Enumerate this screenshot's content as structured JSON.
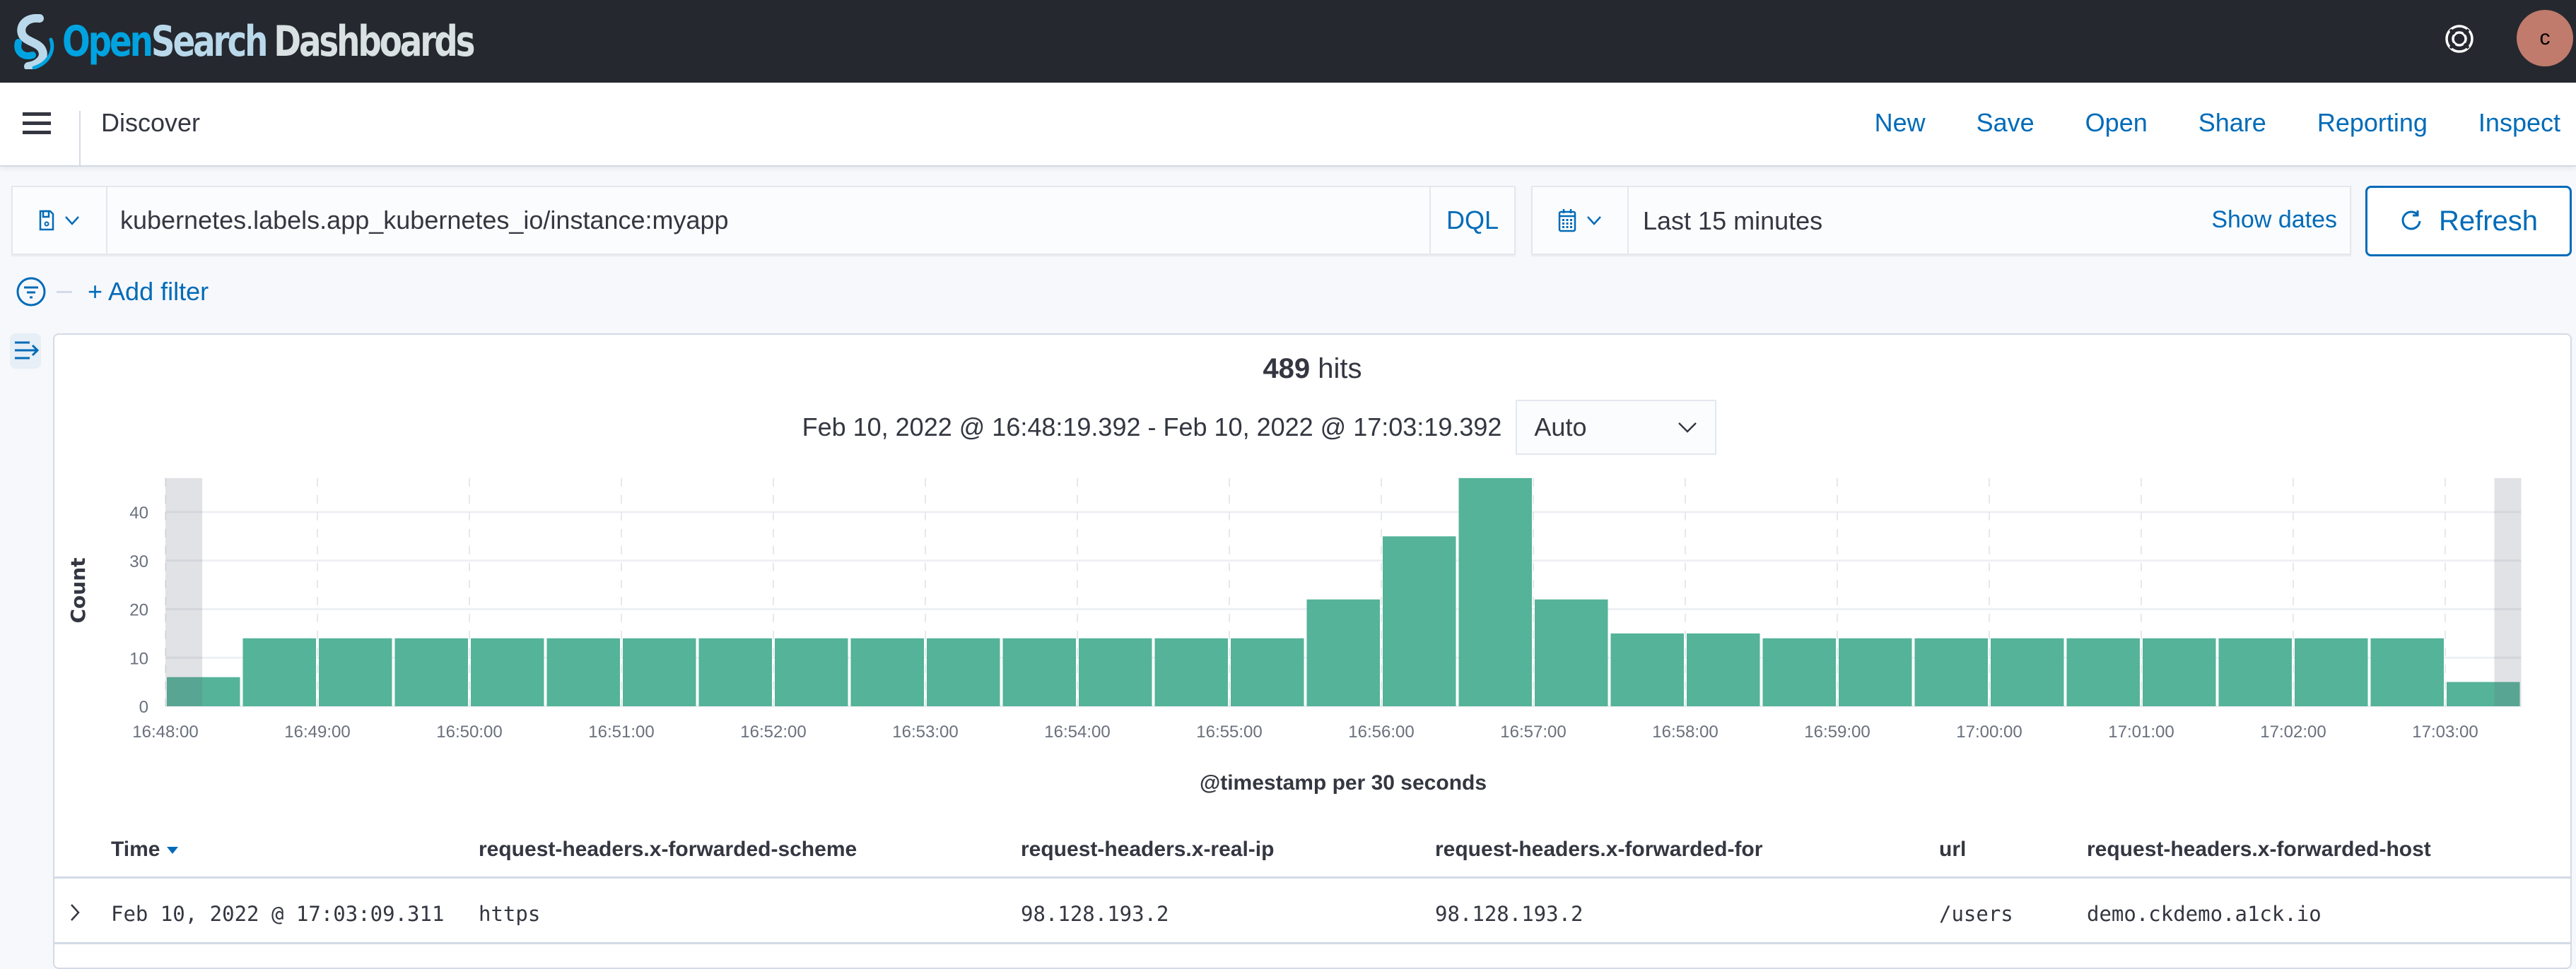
{
  "header": {
    "logo": {
      "open": "Open",
      "search": "Search",
      "dashboards": "Dashboards"
    },
    "help_icon": "help-lifebuoy-icon",
    "avatar_initial": "c",
    "avatar_color": "#c07b6c"
  },
  "subheader": {
    "title": "Discover",
    "nav": [
      "New",
      "Save",
      "Open",
      "Share",
      "Reporting",
      "Inspect"
    ]
  },
  "query": {
    "value": "kubernetes.labels.app_kubernetes_io/instance:myapp",
    "language": "DQL"
  },
  "datepicker": {
    "value": "Last 15 minutes",
    "show_dates_label": "Show dates"
  },
  "refresh_label": "Refresh",
  "filter": {
    "add_label": "+ Add filter"
  },
  "summary": {
    "hits_count": "489",
    "hits_label": " hits",
    "range": "Feb 10, 2022 @ 16:48:19.392 - Feb 10, 2022 @ 17:03:19.392",
    "interval": "Auto"
  },
  "colors": {
    "accent": "#006bb8",
    "bar": "#54b399",
    "topbar": "#25282f"
  },
  "chart_data": {
    "type": "bar",
    "title": "",
    "xlabel": "@timestamp per 30 seconds",
    "ylabel": "Count",
    "ylim": [
      0,
      47
    ],
    "yticks": [
      0,
      10,
      20,
      30,
      40
    ],
    "grid": true,
    "legend": "none",
    "categories": [
      "16:48:00",
      "16:48:30",
      "16:49:00",
      "16:49:30",
      "16:50:00",
      "16:50:30",
      "16:51:00",
      "16:51:30",
      "16:52:00",
      "16:52:30",
      "16:53:00",
      "16:53:30",
      "16:54:00",
      "16:54:30",
      "16:55:00",
      "16:55:30",
      "16:56:00",
      "16:56:30",
      "16:57:00",
      "16:57:30",
      "16:58:00",
      "16:58:30",
      "16:59:00",
      "16:59:30",
      "17:00:00",
      "17:00:30",
      "17:01:00",
      "17:01:30",
      "17:02:00",
      "17:02:30",
      "17:03:00"
    ],
    "values": [
      6,
      14,
      14,
      14,
      14,
      14,
      14,
      14,
      14,
      14,
      14,
      14,
      14,
      14,
      14,
      22,
      35,
      47,
      22,
      15,
      15,
      14,
      14,
      14,
      14,
      14,
      14,
      14,
      14,
      14,
      5
    ],
    "xticks": [
      "16:48:00",
      "16:49:00",
      "16:50:00",
      "16:51:00",
      "16:52:00",
      "16:53:00",
      "16:54:00",
      "16:55:00",
      "16:56:00",
      "16:57:00",
      "16:58:00",
      "16:59:00",
      "17:00:00",
      "17:01:00",
      "17:02:00",
      "17:03:00"
    ],
    "out_of_range_regions": [
      "before 16:48:19.392",
      "after 17:03:19.392"
    ]
  },
  "table": {
    "columns": [
      "Time",
      "request-headers.x-forwarded-scheme",
      "request-headers.x-real-ip",
      "request-headers.x-forwarded-for",
      "url",
      "request-headers.x-forwarded-host"
    ],
    "rows": [
      [
        "Feb 10, 2022 @ 17:03:09.311",
        "https",
        "98.128.193.2",
        "98.128.193.2",
        "/users",
        "demo.ckdemo.a1ck.io"
      ]
    ]
  }
}
